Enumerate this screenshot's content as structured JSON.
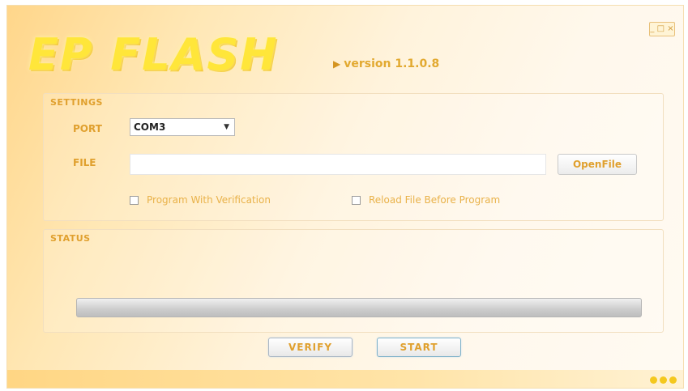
{
  "app": {
    "logo_text": "EP FLASH",
    "version_text": "version 1.1.0.8",
    "minimize_label": "_ □ ×"
  },
  "settings": {
    "group_label": "SETTINGS",
    "port_label": "PORT",
    "port_value": "COM3",
    "file_label": "FILE",
    "file_value": "",
    "open_file_label": "OpenFile",
    "checkbox_verify_label": "Program With Verification",
    "checkbox_reload_label": "Reload File Before Program"
  },
  "status": {
    "group_label": "STATUS",
    "progress": 0
  },
  "actions": {
    "verify_label": "VERIFY",
    "start_label": "START"
  },
  "colors": {
    "accent": "#e0a02e",
    "logo": "#ffe63a",
    "background": "#ffe7b4"
  },
  "icons": {
    "dropdown": "chevron-down-icon",
    "status_dots": "three-dots-icon"
  }
}
